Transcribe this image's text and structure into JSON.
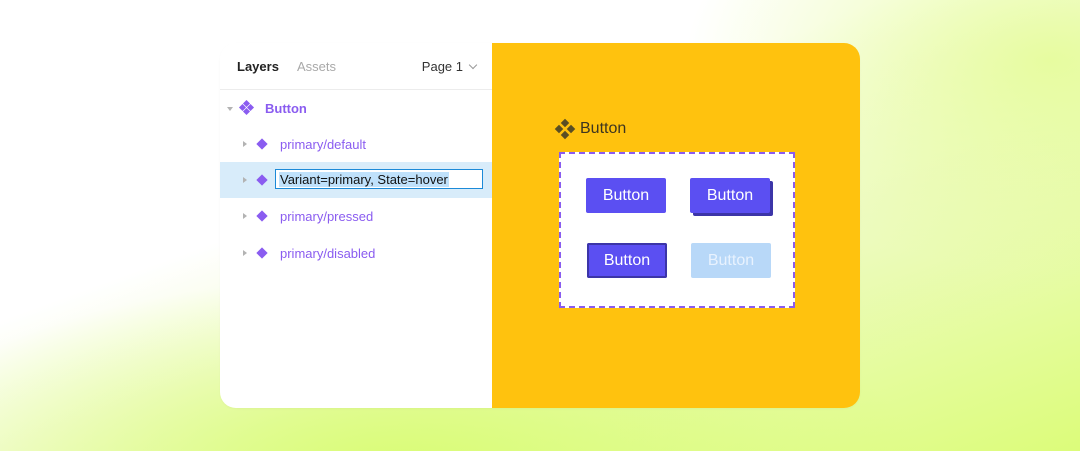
{
  "panel": {
    "tabs": {
      "layers": "Layers",
      "assets": "Assets"
    },
    "page_select": {
      "label": "Page 1"
    },
    "tree": {
      "root": {
        "label": "Button",
        "icon": "component-set-icon"
      },
      "children": [
        {
          "label": "primary/default",
          "icon": "component-icon",
          "selected": false
        },
        {
          "label": "Variant=primary, State=hover",
          "icon": "component-icon",
          "selected": true,
          "editing": true
        },
        {
          "label": "primary/pressed",
          "icon": "component-icon",
          "selected": false
        },
        {
          "label": "primary/disabled",
          "icon": "component-icon",
          "selected": false
        }
      ]
    }
  },
  "canvas": {
    "component_set_title": "Button",
    "buttons": [
      {
        "label": "Button",
        "state": "default"
      },
      {
        "label": "Button",
        "state": "hover"
      },
      {
        "label": "Button",
        "state": "pressed"
      },
      {
        "label": "Button",
        "state": "disabled"
      }
    ]
  },
  "colors": {
    "canvas_bg": "#ffc20e",
    "component_purple": "#8a5cf0",
    "button_primary": "#5b4ff2",
    "button_disabled": "#b8d8f8",
    "selection_bg": "#d8ecfa",
    "rename_border": "#1c8ad8"
  }
}
